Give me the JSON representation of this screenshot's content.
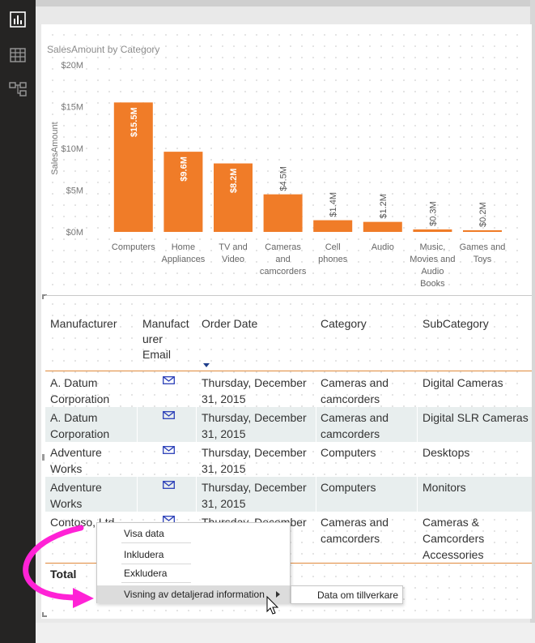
{
  "sidebar": {
    "items": [
      {
        "icon": "report-view-icon"
      },
      {
        "icon": "data-view-icon"
      },
      {
        "icon": "model-view-icon"
      }
    ]
  },
  "colors": {
    "bar": "#f07c28",
    "header_line": "#e0893b",
    "alt_row": "#e8eeee",
    "highlight_arrow": "#ff22d6",
    "mail_icon": "#2b3fb8"
  },
  "chart_data": {
    "type": "bar",
    "title": "SalesAmount by Category",
    "xlabel": "",
    "ylabel": "SalesAmount",
    "ylim": [
      0,
      20
    ],
    "y_unit": "M",
    "yticks": [
      "$0M",
      "$5M",
      "$10M",
      "$15M",
      "$20M"
    ],
    "categories": [
      "Computers",
      "Home Appliances",
      "TV and Video",
      "Cameras and camcorders",
      "Cell phones",
      "Audio",
      "Music, Movies and Audio Books",
      "Games and Toys"
    ],
    "category_lines": [
      [
        "Computers"
      ],
      [
        "Home",
        "Appliances"
      ],
      [
        "TV and",
        "Video"
      ],
      [
        "Cameras",
        "and",
        "camcorders"
      ],
      [
        "Cell",
        "phones"
      ],
      [
        "Audio"
      ],
      [
        "Music,",
        "Movies and",
        "Audio",
        "Books"
      ],
      [
        "Games and",
        "Toys"
      ]
    ],
    "values": [
      15.5,
      9.6,
      8.2,
      4.5,
      1.4,
      1.2,
      0.3,
      0.2
    ],
    "labels": [
      "$15.5M",
      "$9.6M",
      "$8.2M",
      "$4.5M",
      "$1.4M",
      "$1.2M",
      "$0.3M",
      "$0.2M"
    ],
    "grid": false
  },
  "table": {
    "headers": [
      {
        "lines": [
          "Manufacturer"
        ]
      },
      {
        "lines": [
          "Manufact",
          "urer",
          "Email"
        ]
      },
      {
        "lines": [
          "Order Date"
        ],
        "sort": "descending"
      },
      {
        "lines": [
          "Category"
        ]
      },
      {
        "lines": [
          "SubCategory"
        ]
      }
    ],
    "rows": [
      {
        "manufacturer": [
          "A. Datum",
          "Corporation"
        ],
        "order_date": [
          "Thursday, December",
          "31, 2015"
        ],
        "category": [
          "Cameras and",
          "camcorders"
        ],
        "subcategory": [
          "Digital Cameras"
        ]
      },
      {
        "manufacturer": [
          "A. Datum",
          "Corporation"
        ],
        "order_date": [
          "Thursday, December",
          "31, 2015"
        ],
        "category": [
          "Cameras and",
          "camcorders"
        ],
        "subcategory": [
          "Digital SLR Cameras"
        ]
      },
      {
        "manufacturer": [
          "Adventure",
          "Works"
        ],
        "order_date": [
          "Thursday, December",
          "31, 2015"
        ],
        "category": [
          "Computers"
        ],
        "subcategory": [
          "Desktops"
        ]
      },
      {
        "manufacturer": [
          "Adventure",
          "Works"
        ],
        "order_date": [
          "Thursday, December",
          "31, 2015"
        ],
        "category": [
          "Computers"
        ],
        "subcategory": [
          "Monitors"
        ]
      },
      {
        "manufacturer": [
          "Contoso, Ltd",
          ""
        ],
        "order_date": [
          "Thursday, December",
          ""
        ],
        "category": [
          "Cameras and",
          "camcorders"
        ],
        "subcategory": [
          "Cameras &",
          "Camcorders",
          "Accessories"
        ]
      }
    ],
    "total_label": "Total"
  },
  "context_menu": {
    "items": [
      "Visa data",
      "Inkludera",
      "Exkludera",
      "Visning av detaljerad information"
    ],
    "highlighted": "Visning av detaljerad information",
    "submenu": [
      "Data om tillverkare"
    ]
  }
}
